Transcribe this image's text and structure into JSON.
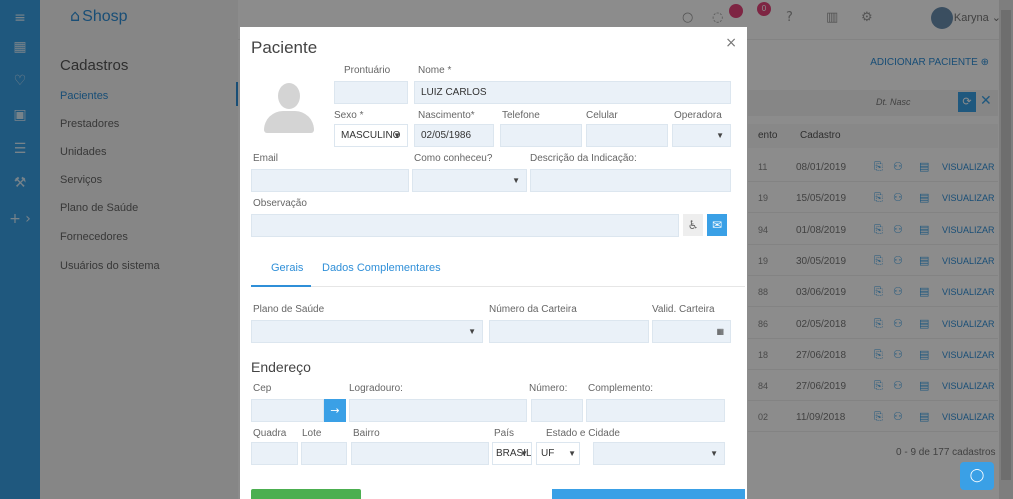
{
  "app": {
    "brand": "Shosp",
    "user": "Karyna",
    "notification_count": "0",
    "add_patient": "ADICIONAR PACIENTE",
    "filter_label": "Dt. Nasc"
  },
  "sidebar": {
    "title": "Cadastros",
    "items": [
      {
        "label": "Pacientes"
      },
      {
        "label": "Prestadores"
      },
      {
        "label": "Unidades"
      },
      {
        "label": "Serviços"
      },
      {
        "label": "Plano de Saúde"
      },
      {
        "label": "Fornecedores"
      },
      {
        "label": "Usuários do sistema"
      }
    ]
  },
  "table": {
    "col_partial": "ento",
    "col_date": "Cadastro",
    "action": "VISUALIZAR",
    "rows": [
      {
        "frag": "11",
        "date": "08/01/2019"
      },
      {
        "frag": "19",
        "date": "15/05/2019"
      },
      {
        "frag": "94",
        "date": "01/08/2019"
      },
      {
        "frag": "19",
        "date": "30/05/2019"
      },
      {
        "frag": "88",
        "date": "03/06/2019"
      },
      {
        "frag": "86",
        "date": "02/05/2018"
      },
      {
        "frag": "18",
        "date": "27/06/2018"
      },
      {
        "frag": "84",
        "date": "27/06/2019"
      },
      {
        "frag": "02",
        "date": "11/09/2018"
      }
    ],
    "pager": "0 - 9 de 177 cadastros"
  },
  "modal": {
    "title": "Paciente",
    "close": "×",
    "labels": {
      "prontuario": "Prontuário",
      "nome": "Nome *",
      "sexo": "Sexo *",
      "nascimento": "Nascimento*",
      "telefone": "Telefone",
      "celular": "Celular",
      "operadora": "Operadora",
      "email": "Email",
      "como_conheceu": "Como conheceu?",
      "descricao": "Descrição da Indicação:",
      "observacao": "Observação",
      "plano": "Plano de Saúde",
      "numero_carteira": "Número da Carteira",
      "valid_carteira": "Valid. Carteira",
      "endereco": "Endereço",
      "cep": "Cep",
      "logradouro": "Logradouro:",
      "numero": "Número:",
      "complemento": "Complemento:",
      "quadra": "Quadra",
      "lote": "Lote",
      "bairro": "Bairro",
      "pais": "País",
      "estado_cidade": "Estado e Cidade"
    },
    "values": {
      "prontuario": "",
      "nome": "LUIZ CARLOS",
      "sexo": "MASCULINO",
      "nascimento": "02/05/1986",
      "pais": "BRASIL",
      "uf": "UF"
    },
    "tabs": [
      {
        "label": "Gerais"
      },
      {
        "label": "Dados Complementares"
      }
    ]
  }
}
